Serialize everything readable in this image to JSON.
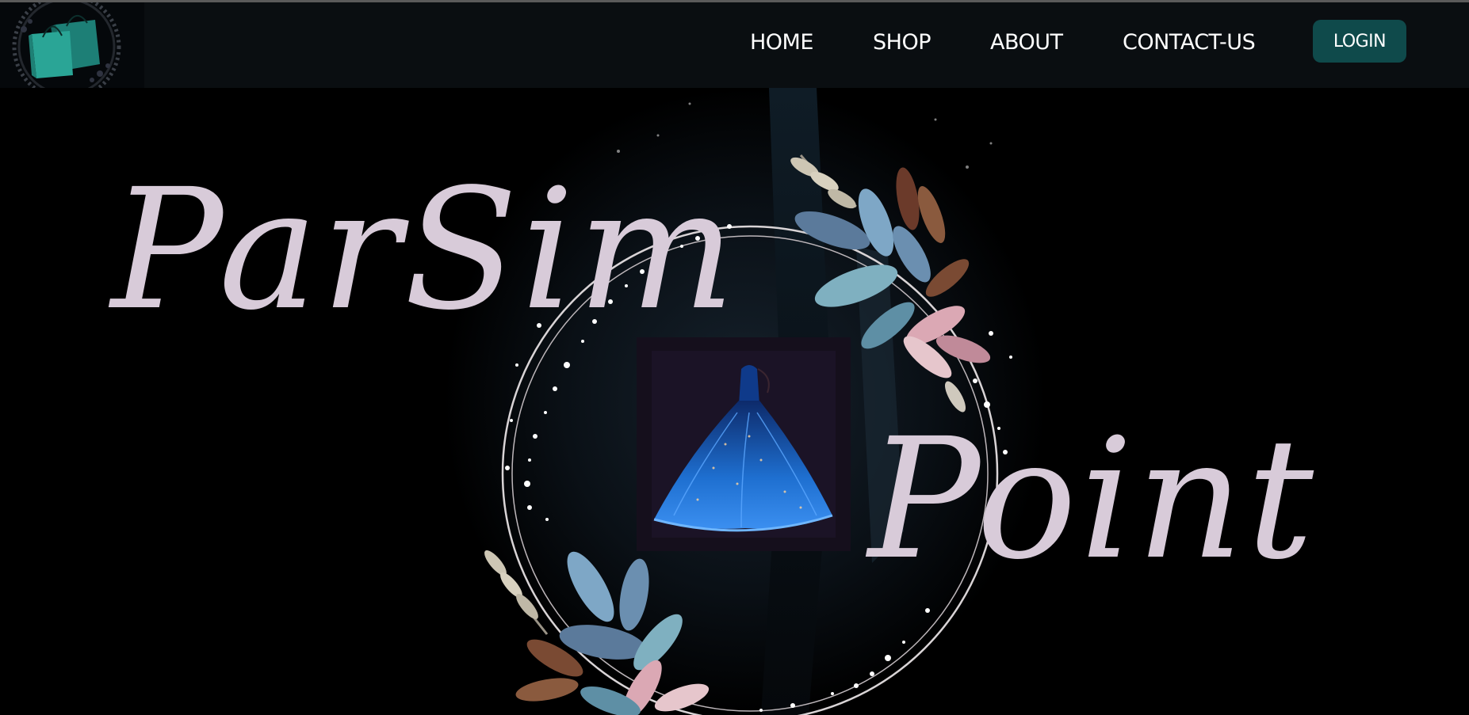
{
  "nav": {
    "links": [
      {
        "label": "HOME"
      },
      {
        "label": "SHOP"
      },
      {
        "label": "ABOUT"
      },
      {
        "label": "CONTACT-US"
      }
    ],
    "login_label": "LOGIN"
  },
  "hero": {
    "brand_part1": "ParSim",
    "brand_part2": "Point"
  },
  "icons": {
    "logo": "shopping-bags-logo-icon",
    "hero_image": "ball-gown-dress-icon"
  },
  "colors": {
    "navbar_bg": "#0a0e11",
    "login_bg": "#0f4a4b",
    "brand_text": "#d8cbd9",
    "gown": "#1e6fd0"
  }
}
